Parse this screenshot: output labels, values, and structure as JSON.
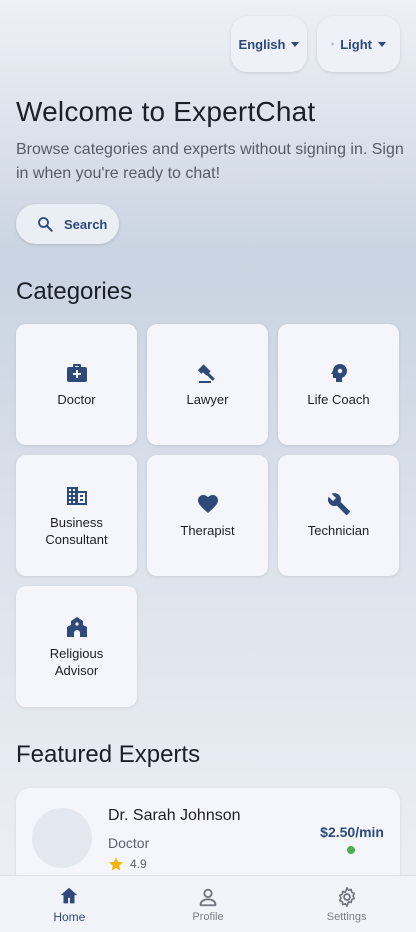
{
  "header": {
    "language_label": "English",
    "theme_label": "Light"
  },
  "welcome": {
    "title": "Welcome to ExpertChat",
    "subtitle": "Browse categories and experts without signing in. Sign in when you're ready to chat!"
  },
  "search": {
    "label": "Search"
  },
  "categories": {
    "title": "Categories",
    "items": [
      {
        "label": "Doctor",
        "icon": "medical-bag-icon"
      },
      {
        "label": "Lawyer",
        "icon": "gavel-icon"
      },
      {
        "label": "Life Coach",
        "icon": "psychology-icon"
      },
      {
        "label": "Business Consultant",
        "icon": "business-icon"
      },
      {
        "label": "Therapist",
        "icon": "heart-icon"
      },
      {
        "label": "Technician",
        "icon": "wrench-icon"
      },
      {
        "label": "Religious Advisor",
        "icon": "place-of-worship-icon"
      }
    ]
  },
  "featured": {
    "title": "Featured Experts",
    "experts": [
      {
        "name": "Dr. Sarah Johnson",
        "category": "Doctor",
        "rating": "4.9",
        "price": "$2.50/min",
        "online": true
      }
    ]
  },
  "bottom_nav": {
    "items": [
      {
        "label": "Home",
        "icon": "home-icon",
        "active": true
      },
      {
        "label": "Profile",
        "icon": "person-icon",
        "active": false
      },
      {
        "label": "Settings",
        "icon": "gear-icon",
        "active": false
      }
    ]
  },
  "colors": {
    "accent": "#2d4a7a",
    "online": "#4caf50",
    "star": "#f5b400"
  }
}
